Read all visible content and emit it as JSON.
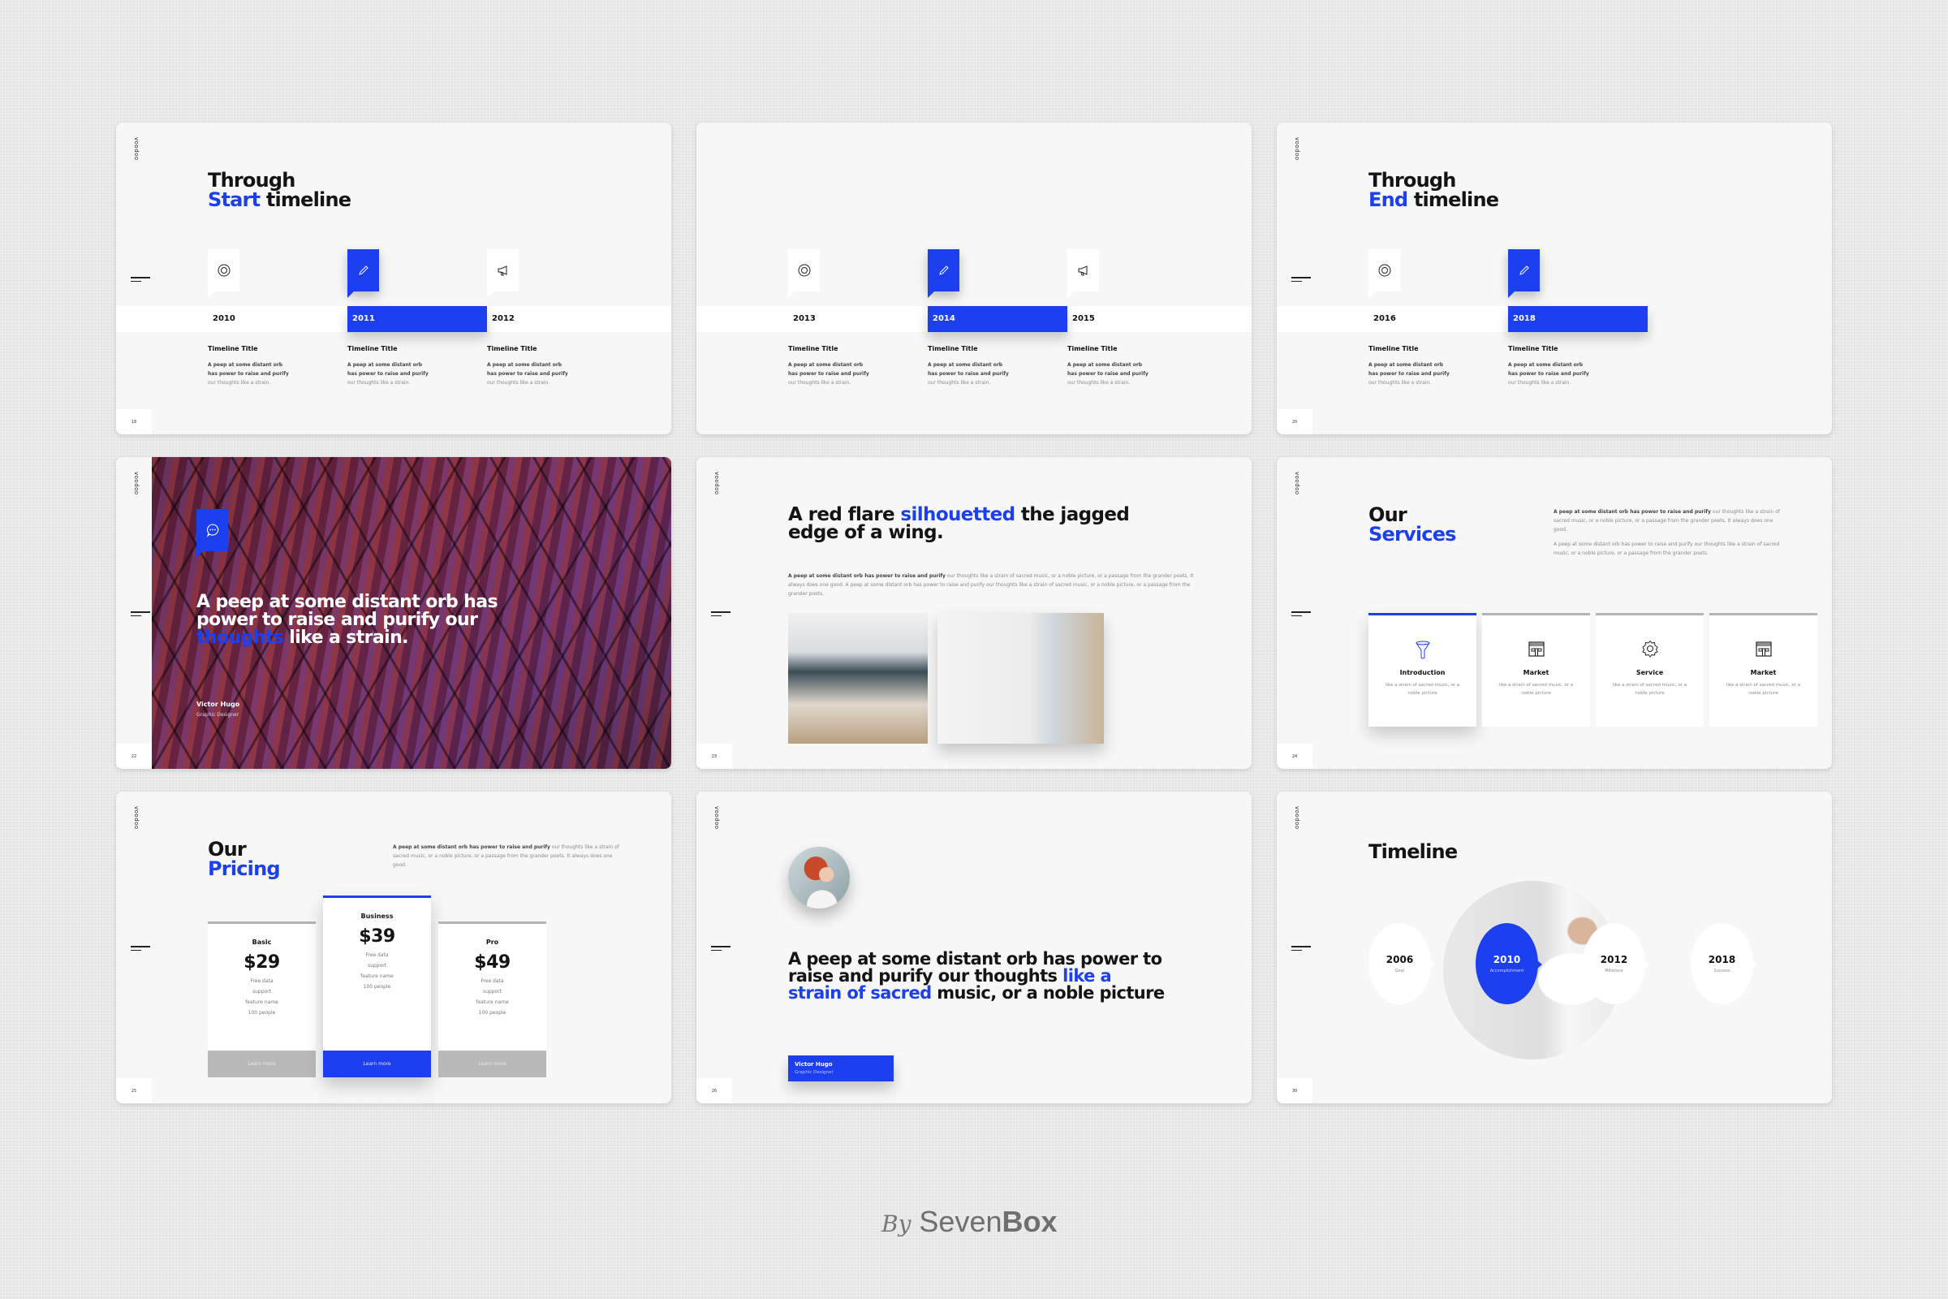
{
  "brand": "voodoo",
  "accent_color": "#1c3ff0",
  "slides": {
    "s1": {
      "page": "18",
      "title_line1": "Through",
      "title_blue": "Start",
      "title_rest": " timeline",
      "items": [
        {
          "year": "2010",
          "icon": "lifebuoy-icon",
          "title": "Timeline Title",
          "desc_bold": "A peep at some distant orb has power to raise and purify",
          "desc": " our thoughts like a strain."
        },
        {
          "year": "2011",
          "icon": "pencil-icon",
          "title": "Timeline Title",
          "desc_bold": "A peep at some distant orb has power to raise and purify",
          "desc": " our thoughts like a strain.",
          "active": true
        },
        {
          "year": "2012",
          "icon": "megaphone-icon",
          "title": "Timeline Title",
          "desc_bold": "A peep at some distant orb has power to raise and purify",
          "desc": " our thoughts like a strain."
        }
      ]
    },
    "s2": {
      "items": [
        {
          "year": "2013",
          "icon": "lifebuoy-icon",
          "title": "Timeline Title",
          "desc_bold": "A peep at some distant orb has power to raise and purify",
          "desc": " our thoughts like a strain."
        },
        {
          "year": "2014",
          "icon": "pencil-icon",
          "title": "Timeline Title",
          "desc_bold": "A peep at some distant orb has power to raise and purify",
          "desc": " our thoughts like a strain.",
          "active": true
        },
        {
          "year": "2015",
          "icon": "megaphone-icon",
          "title": "Timeline Title",
          "desc_bold": "A peep at some distant orb has power to raise and purify",
          "desc": " our thoughts like a strain."
        }
      ]
    },
    "s3": {
      "page": "20",
      "title_line1": "Through",
      "title_blue": "End",
      "title_rest": " timeline",
      "items": [
        {
          "year": "2016",
          "icon": "lifebuoy-icon",
          "title": "Timeline Title",
          "desc_bold": "A peep at some distant orb has power to raise and purify",
          "desc": " our thoughts like a strain."
        },
        {
          "year": "2018",
          "icon": "pencil-icon",
          "title": "Timeline Title",
          "desc_bold": "A peep at some distant orb has power to raise and purify",
          "desc": " our thoughts like a strain.",
          "active": true
        }
      ]
    },
    "s4": {
      "page": "22",
      "quote_a": "A peep at some distant orb has power to raise and purify our ",
      "quote_blue": "thoughts",
      "quote_b": " like a strain.",
      "author": "Victor Hugo",
      "role": "Graphic Designer"
    },
    "s5": {
      "page": "23",
      "title_a": "A red flare ",
      "title_blue": "silhouetted",
      "title_b": " the jagged edge of a wing.",
      "para_bold": "A peep at some distant orb has power to raise and purify",
      "para": " our thoughts like a strain of sacred music, or a noble picture, or a passage from the grander poets. It always does one good. A peep at some distant orb has power to raise and purify our thoughts like a strain of sacred music, or a noble picture, or a passage from the grander poets."
    },
    "s6": {
      "page": "24",
      "title_line1": "Our",
      "title_blue": "Services",
      "p1_bold": "A peep at some distant orb has power to raise and purify",
      "p1": " our thoughts like a strain of sacred music, or a noble picture, or a passage from the grander poets. It always does one good.",
      "p2": "A peep at some distant orb has power to raise and purify our thoughts like a strain of sacred music, or a noble picture, or a passage from the grander poets.",
      "cards": [
        {
          "name": "Introduction",
          "icon": "funnel-icon",
          "desc": "like a strain of sacred music, or a noble picture",
          "active": true
        },
        {
          "name": "Market",
          "icon": "storefront-icon",
          "desc": "like a strain of sacred music, or a noble picture"
        },
        {
          "name": "Service",
          "icon": "gear-icon",
          "desc": "like a strain of sacred music, or a noble picture"
        },
        {
          "name": "Market",
          "icon": "storefront-icon",
          "desc": "like a strain of sacred music, or a noble picture"
        }
      ]
    },
    "s7": {
      "page": "25",
      "title_line1": "Our",
      "title_blue": "Pricing",
      "para_bold": "A peep at some distant orb has power to raise and purify",
      "para": " our thoughts like a strain of sacred music, or a noble picture, or a passage from the grander poets. It always does one good.",
      "plans": [
        {
          "name": "Basic",
          "price": "$29",
          "features": [
            "Free data",
            "support",
            "feature name",
            "100 people"
          ],
          "button": "Learn more"
        },
        {
          "name": "Business",
          "price": "$39",
          "features": [
            "Free data",
            "support",
            "feature name",
            "100 people"
          ],
          "button": "Learn more",
          "active": true
        },
        {
          "name": "Pro",
          "price": "$49",
          "features": [
            "Free data",
            "support",
            "feature name",
            "100 people"
          ],
          "button": "Learn more"
        }
      ]
    },
    "s8": {
      "page": "26",
      "quote_a": "A peep at some distant orb has power to raise and purify our thoughts ",
      "quote_blue": "like a strain of sacred",
      "quote_b": " music, or a noble picture",
      "author": "Victor Hugo",
      "role": "Graphic Designer"
    },
    "s9": {
      "page": "30",
      "title": "Timeline",
      "milestones": [
        {
          "year": "2006",
          "label": "Goal"
        },
        {
          "year": "2010",
          "label": "Accomplishment",
          "active": true
        },
        {
          "year": "2012",
          "label": "Millstone"
        },
        {
          "year": "2018",
          "label": "Success"
        }
      ]
    }
  },
  "footer": {
    "by": "By",
    "name_a": "Seven",
    "name_b": "Box"
  }
}
